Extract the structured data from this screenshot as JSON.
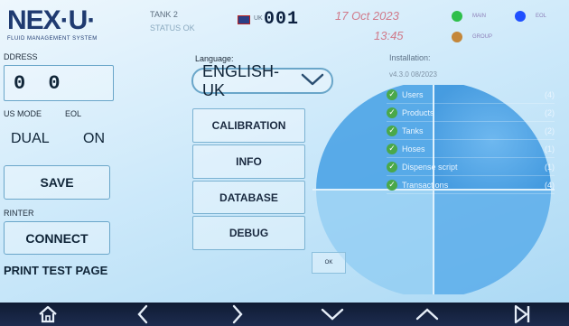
{
  "header": {
    "brand": "NEX·U·",
    "brand_subtitle": "FLUID MANAGEMENT SYSTEM",
    "tank_label": "TANK 2",
    "status_label": "STATUS OK",
    "flag_label": "UK",
    "counter": "001",
    "date": "17 Oct 2023",
    "time": "13:45",
    "indicators": [
      {
        "label": "MAIN",
        "color": "#2fbf4b"
      },
      {
        "label": "EOL",
        "color": "#1f4fff"
      },
      {
        "label": "GROUP",
        "color": "#c4873a"
      }
    ]
  },
  "left": {
    "address_label": "DDRESS",
    "address_value": "0 0",
    "bus_mode_label": "US MODE",
    "eol_label": "EOL",
    "bus_mode_value": "DUAL",
    "eol_value": "ON",
    "save_label": "SAVE",
    "printer_label": "RINTER",
    "connect_label": "CONNECT",
    "print_test_label": "PRINT TEST PAGE"
  },
  "middle": {
    "language_label": "Language:",
    "language_value": "ENGLISH-UK",
    "buttons": [
      "CALIBRATION",
      "INFO",
      "DATABASE",
      "DEBUG"
    ],
    "ok_label": "OK"
  },
  "installation": {
    "label": "Installation:",
    "version": "v4.3.0 08/2023",
    "items": [
      {
        "name": "Users",
        "count": "(4)"
      },
      {
        "name": "Products",
        "count": "(2)"
      },
      {
        "name": "Tanks",
        "count": "(2)"
      },
      {
        "name": "Hoses",
        "count": "(1)"
      },
      {
        "name": "Dispense script",
        "count": "(1)"
      },
      {
        "name": "Transactions",
        "count": "(4)"
      }
    ]
  },
  "nav": {
    "icons": [
      "home-icon",
      "chevron-left-icon",
      "chevron-right-icon",
      "chevron-down-icon",
      "chevron-up-icon",
      "skip-forward-icon"
    ]
  }
}
